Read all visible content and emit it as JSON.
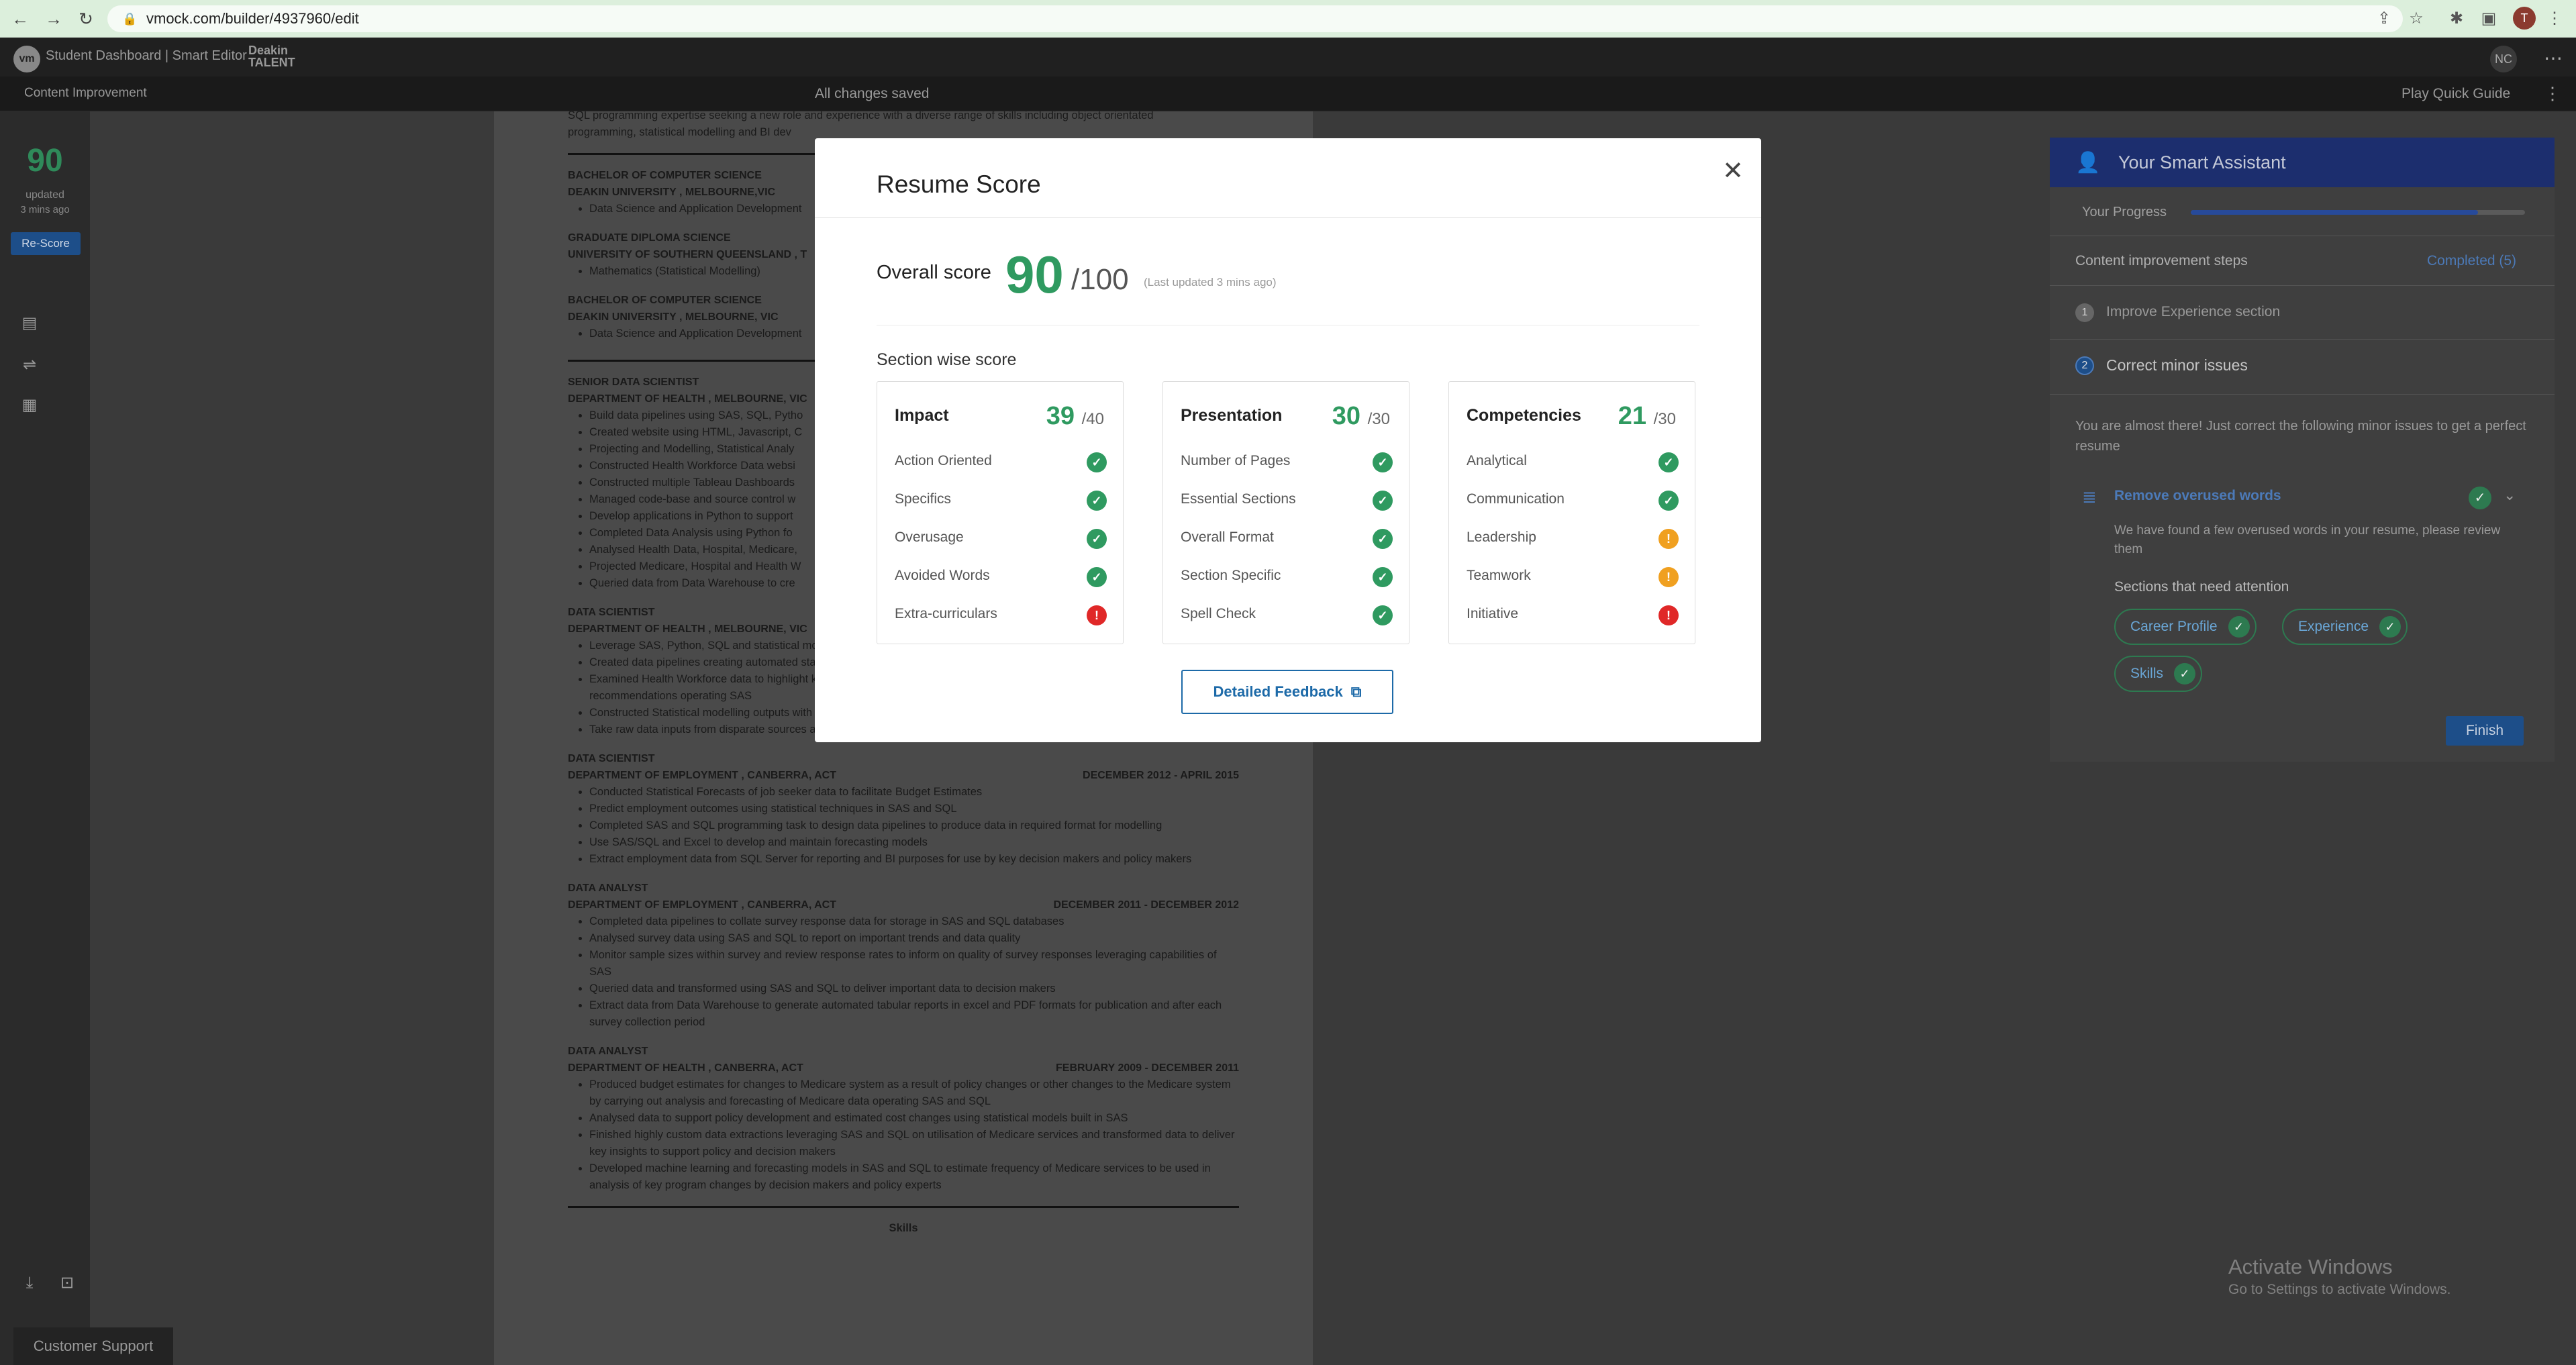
{
  "browser": {
    "url": "vmock.com/builder/4937960/edit",
    "nav_icons": [
      "back-icon",
      "forward-icon",
      "reload-icon"
    ],
    "avatar_letter": "T"
  },
  "app": {
    "title": "Student Dashboard | Smart Editor",
    "partner_line1": "Deakin",
    "partner_line2": "TALENT",
    "user_initials": "NC",
    "mode": "Content Improvement",
    "save_status": "All changes saved",
    "quick_guide": "Play Quick Guide"
  },
  "left_sidebar": {
    "score": "90",
    "updated_label": "updated",
    "updated_ago": "3 mins ago",
    "rescore_label": "Re-Score",
    "customer_support": "Customer Support"
  },
  "document": {
    "intro": [
      "SQL programming expertise seeking a new role and experience with a diverse range of skills including object orientated",
      "programming, statistical modelling and BI dev"
    ],
    "education": [
      {
        "degree": "BACHELOR OF COMPUTER SCIENCE",
        "school": "DEAKIN UNIVERSITY ,   Melbourne,VIC",
        "detail": "Data Science and Application Development"
      },
      {
        "degree": "GRADUATE DIPLOMA SCIENCE",
        "school": "UNIVERSITY OF SOUTHERN QUEENSLAND ,  T",
        "detail": "Mathematics (Statistical Modelling)"
      },
      {
        "degree": "BACHELOR OF COMPUTER SCIENCE",
        "school": "DEAKIN UNIVERSITY ,   Melbourne, VIC",
        "detail": "Data Science and Application Development"
      }
    ],
    "experience": [
      {
        "title": "SENIOR DATA SCIENTIST",
        "org": "DEPARTMENT OF HEALTH ,   MELBOURNE, VIC",
        "dates": "",
        "bullets": [
          "Build data pipelines using SAS, SQL, Pytho",
          "Created website using HTML, Javascript, C",
          "Projecting and Modelling, Statistical Analy",
          "Constructed Health Workforce Data websi",
          "Constructed multiple Tableau Dashboards",
          "Managed code-base and source control w",
          "Develop applications in Python to support",
          "Completed Data Analysis using Python fo",
          "Analysed Health Data, Hospital, Medicare,",
          "Projected Medicare, Hospital and Health W",
          "Queried data from Data Warehouse to cre"
        ]
      },
      {
        "title": "DATA SCIENTIST",
        "org": "DEPARTMENT OF HEALTH ,   MELBOURNE, VIC",
        "dates": "",
        "bullets": [
          "Leverage SAS, Python, SQL and statistical modelling to create reports",
          "Created data pipelines creating automated standard data outputs for use in statistical modelling",
          "Examined Health Workforce data to highlight key trends for decision makers and policy makers producing several key reports and recommendations operating SAS",
          "Constructed Statistical modelling outputs with SAS and Python to report on trends in Health Workforce data to policy makers",
          "Take raw data inputs from disparate sources and convert to data asset stored in SQL database via data pipeline"
        ]
      },
      {
        "title": "DATA SCIENTIST",
        "org": "DEPARTMENT OF EMPLOYMENT ,   CANBERRA, ACT",
        "dates": "December 2012 - April 2015",
        "bullets": [
          "Conducted Statistical Forecasts of job seeker data to facilitate Budget Estimates",
          "Predict employment outcomes using statistical techniques in  SAS and SQL",
          "Completed SAS and SQL programming task to design data pipelines to produce data in required format for modelling",
          "Use SAS/SQL and Excel to develop and maintain forecasting models",
          "Extract employment data from SQL Server for reporting and BI purposes for use by key decision makers and policy makers"
        ]
      },
      {
        "title": "DATA ANALYST",
        "org": "DEPARTMENT OF EMPLOYMENT ,   CANBERRA, ACT",
        "dates": "December 2011 - December 2012",
        "bullets": [
          "Completed data pipelines to collate survey response data for storage in SAS and SQL databases",
          "Analysed survey data using SAS and SQL to report on important trends and data quality",
          "Monitor sample sizes within survey and review response rates to inform on quality of survey responses leveraging capabilities of SAS",
          "Queried data and transformed using SAS and SQL to deliver important data to decision makers",
          "Extract data from Data Warehouse to generate automated tabular reports in excel and PDF formats for publication and after each survey collection period"
        ]
      },
      {
        "title": "DATA ANALYST",
        "org": "DEPARTMENT OF HEALTH ,   CANBERRA, ACT",
        "dates": "February 2009 - December 2011",
        "bullets": [
          "Produced budget estimates for changes to Medicare system as a result of policy changes or other changes to the Medicare system by carrying out analysis and forecasting of Medicare data operating SAS and SQL",
          "Analysed data to support policy development and estimated cost changes using statistical models built in SAS",
          "Finished highly custom data extractions leveraging SAS and SQL on utilisation of Medicare services and transformed data to deliver key insights to support policy and decision makers",
          "Developed machine learning and forecasting models in SAS and SQL to estimate frequency of Medicare services to be used in analysis of key program changes by decision makers and policy experts"
        ]
      }
    ],
    "trailing_heading": "Skills"
  },
  "smart_assistant": {
    "title": "Your Smart Assistant",
    "progress_label": "Your Progress",
    "progress_fraction": 0.86,
    "steps_label": "Content improvement steps",
    "completed_label": "Completed (5)",
    "step1_num": "1",
    "step1_label": "Improve Experience section",
    "step2_num": "2",
    "step2_label": "Correct minor issues",
    "almost_text": "You are almost there! Just correct the following minor issues to get a perfect resume",
    "overused_title": "Remove overused words",
    "overused_desc": "We have found a few overused words in your resume, please review them",
    "attention_label": "Sections that need attention",
    "chips": [
      "Career Profile",
      "Experience",
      "Skills"
    ],
    "finish_label": "Finish"
  },
  "watermark": {
    "title": "Activate Windows",
    "subtitle": "Go to Settings to activate Windows."
  },
  "modal": {
    "title": "Resume Score",
    "close_icon": "close-icon",
    "overall_label": "Overall score",
    "overall_score": "90",
    "overall_max": "/100",
    "last_updated": "(Last updated 3 mins ago)",
    "section_label": "Section wise score",
    "cards": [
      {
        "title": "Impact",
        "score": "39",
        "max": "/40",
        "rows": [
          {
            "label": "Action Oriented",
            "status": "ok"
          },
          {
            "label": "Specifics",
            "status": "ok"
          },
          {
            "label": "Overusage",
            "status": "ok"
          },
          {
            "label": "Avoided Words",
            "status": "ok"
          },
          {
            "label": "Extra-curriculars",
            "status": "err"
          }
        ]
      },
      {
        "title": "Presentation",
        "score": "30",
        "max": "/30",
        "rows": [
          {
            "label": "Number of Pages",
            "status": "ok"
          },
          {
            "label": "Essential Sections",
            "status": "ok"
          },
          {
            "label": "Overall Format",
            "status": "ok"
          },
          {
            "label": "Section Specific",
            "status": "ok"
          },
          {
            "label": "Spell Check",
            "status": "ok"
          }
        ]
      },
      {
        "title": "Competencies",
        "score": "21",
        "max": "/30",
        "rows": [
          {
            "label": "Analytical",
            "status": "ok"
          },
          {
            "label": "Communication",
            "status": "ok"
          },
          {
            "label": "Leadership",
            "status": "warn"
          },
          {
            "label": "Teamwork",
            "status": "warn"
          },
          {
            "label": "Initiative",
            "status": "err"
          }
        ]
      }
    ],
    "detailed_feedback": "Detailed Feedback",
    "status_colors": {
      "ok": "#2f9a60",
      "warn": "#f0a020",
      "err": "#e02828"
    }
  }
}
